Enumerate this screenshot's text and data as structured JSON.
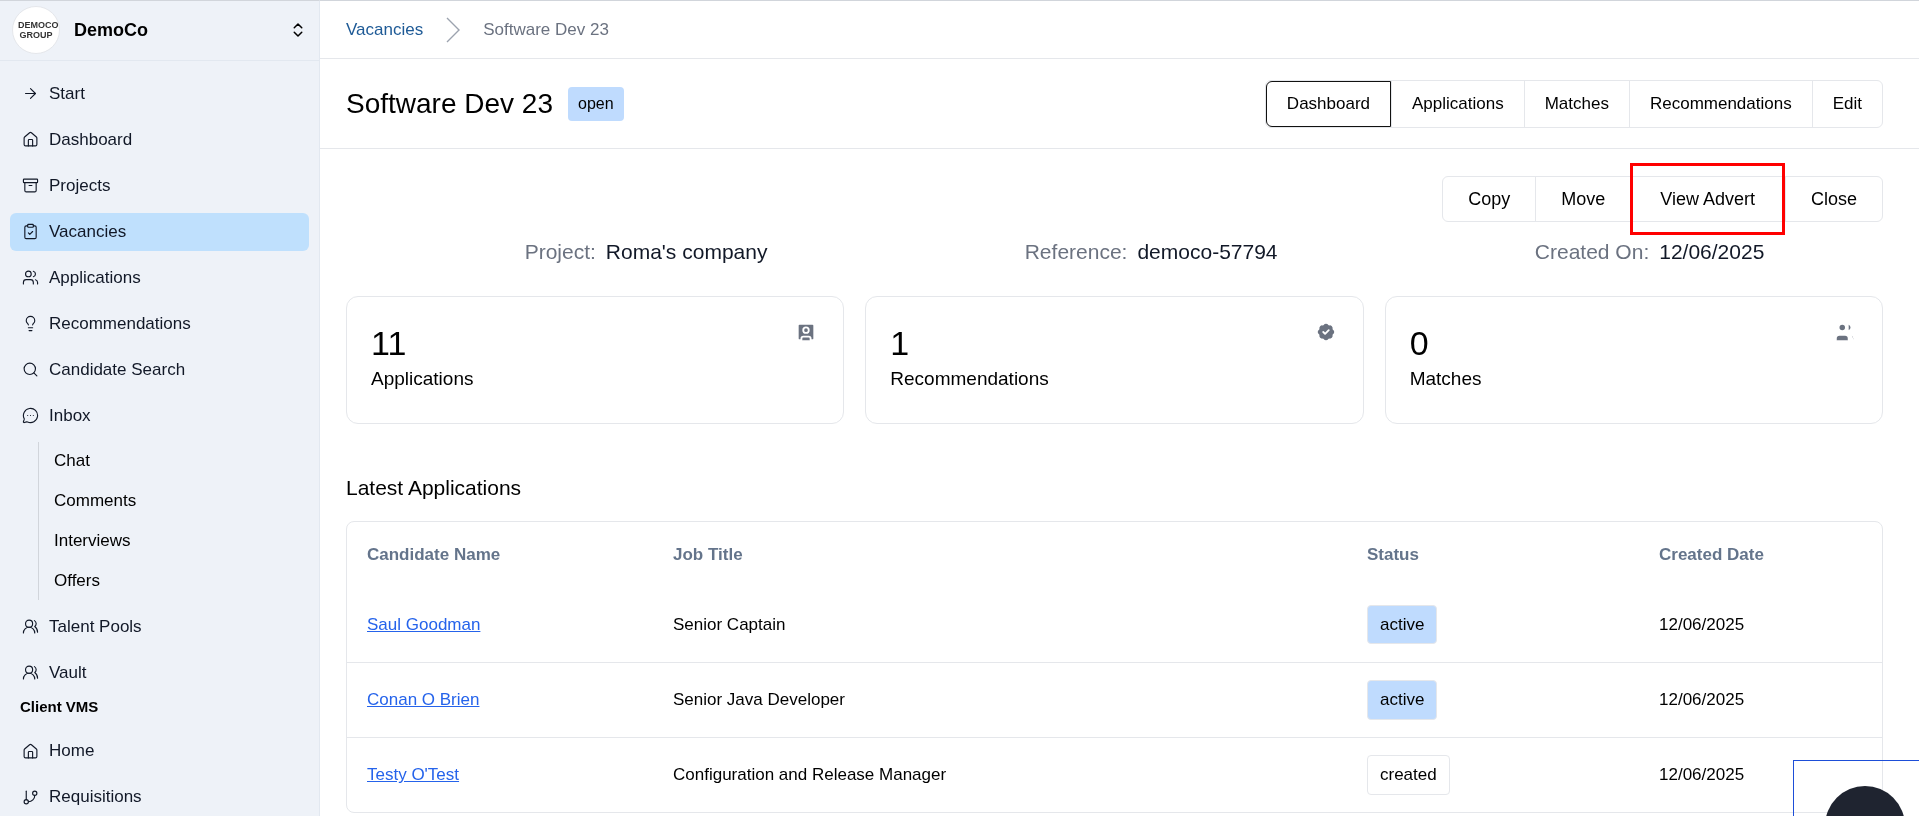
{
  "org": {
    "name": "DemoCo",
    "logo_text": "DEMOCO GROUP"
  },
  "sidebar": {
    "sections": [
      {
        "items": [
          {
            "label": "Start",
            "selected": false
          },
          {
            "label": "Dashboard",
            "selected": false
          },
          {
            "label": "Projects",
            "selected": false
          },
          {
            "label": "Vacancies",
            "selected": true
          },
          {
            "label": "Applications",
            "selected": false
          },
          {
            "label": "Recommendations",
            "selected": false
          },
          {
            "label": "Candidate Search",
            "selected": false
          },
          {
            "label": "Inbox",
            "selected": false,
            "children": [
              {
                "label": "Chat",
                "selected": false
              },
              {
                "label": "Comments",
                "selected": false
              },
              {
                "label": "Interviews",
                "selected": false
              },
              {
                "label": "Offers",
                "selected": false
              }
            ]
          },
          {
            "label": "Talent Pools",
            "selected": false
          },
          {
            "label": "Vault",
            "selected": false
          }
        ]
      },
      {
        "title": "Client VMS",
        "items": [
          {
            "label": "Home",
            "selected": false
          },
          {
            "label": "Requisitions",
            "selected": false
          }
        ]
      }
    ]
  },
  "breadcrumb": [
    "Vacancies",
    "Software Dev 23"
  ],
  "header": {
    "title": "Software Dev 23",
    "badge": {
      "label": "open",
      "color": "#bfdbfe"
    }
  },
  "tabs": [
    {
      "label": "Dashboard",
      "selected": true
    },
    {
      "label": "Applications",
      "selected": false
    },
    {
      "label": "Matches",
      "selected": false
    },
    {
      "label": "Recommendations",
      "selected": false
    },
    {
      "label": "Edit",
      "selected": false
    }
  ],
  "actions": [
    {
      "label": "Copy",
      "highlighted": false
    },
    {
      "label": "Move",
      "highlighted": false
    },
    {
      "label": "View Advert",
      "highlighted": true
    },
    {
      "label": "Close",
      "highlighted": false
    }
  ],
  "meta": [
    {
      "label": "Project:",
      "value": "Roma's company"
    },
    {
      "label": "Reference:",
      "value": "democo-57794"
    },
    {
      "label": "Created On:",
      "value": "12/06/2025"
    }
  ],
  "stats": [
    {
      "value": "11",
      "label": "Applications"
    },
    {
      "value": "1",
      "label": "Recommendations"
    },
    {
      "value": "0",
      "label": "Matches"
    }
  ],
  "latest": {
    "title": "Latest Applications",
    "columns": [
      "Candidate Name",
      "Job Title",
      "Status",
      "Created Date"
    ],
    "rows": [
      {
        "name": "Saul Goodman",
        "job": "Senior Captain",
        "status": {
          "label": "active",
          "color": "#bfdbfe"
        },
        "date": "12/06/2025"
      },
      {
        "name": "Conan O Brien",
        "job": "Senior Java Developer",
        "status": {
          "label": "active",
          "color": "#bfdbfe"
        },
        "date": "12/06/2025"
      },
      {
        "name": "Testy O'Test",
        "job": "Configuration and Release Manager",
        "status": {
          "label": "created",
          "color": "#ffffff"
        },
        "date": "12/06/2025"
      }
    ]
  }
}
